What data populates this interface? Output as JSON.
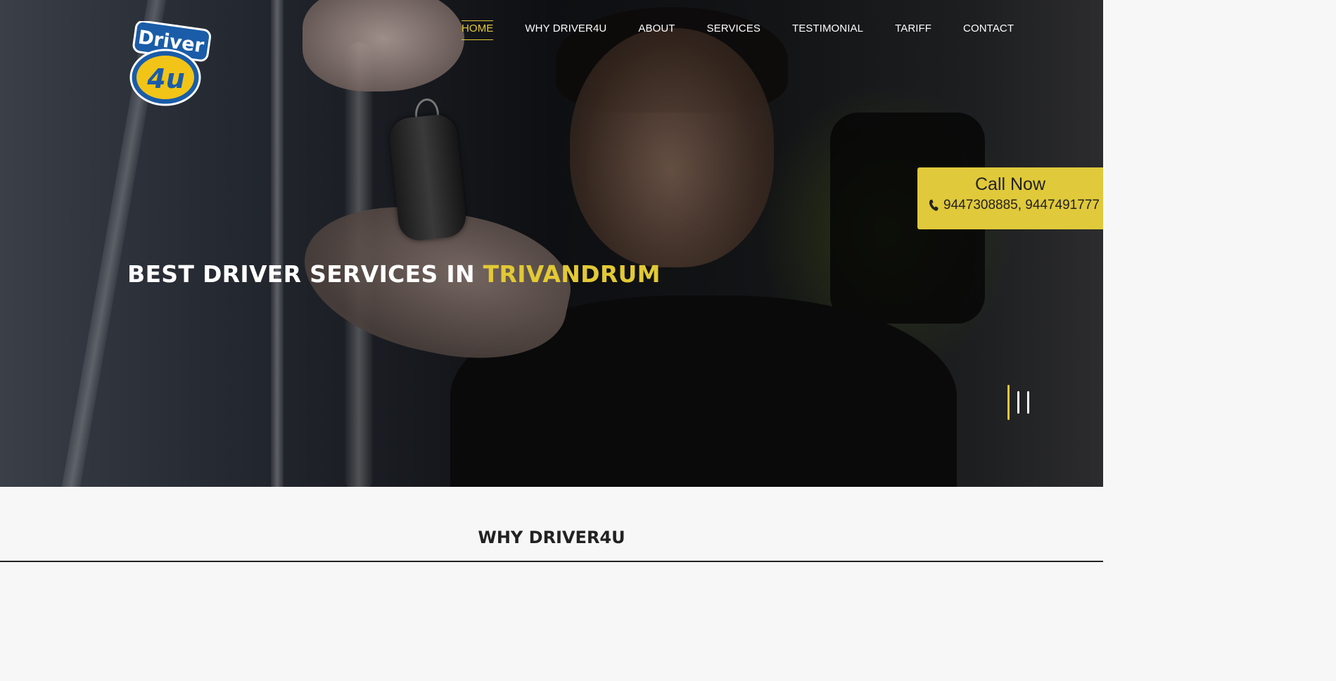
{
  "logo": {
    "line1": "Driver",
    "line2": "4u"
  },
  "nav": {
    "items": [
      {
        "label": "HOME",
        "active": true
      },
      {
        "label": "WHY DRIVER4U"
      },
      {
        "label": "ABOUT"
      },
      {
        "label": "SERVICES"
      },
      {
        "label": "TESTIMONIAL"
      },
      {
        "label": "TARIFF"
      },
      {
        "label": "CONTACT"
      }
    ]
  },
  "hero": {
    "headline_main": "BEST DRIVER SERVICES IN ",
    "headline_accent": "TRIVANDRUM",
    "slide_count": 3,
    "active_slide": 1
  },
  "call_box": {
    "title": "Call Now",
    "numbers": "9447308885, 9447491777",
    "icon": "phone-icon"
  },
  "section": {
    "title": "WHY DRIVER4U"
  },
  "colors": {
    "accent": "#e2c935",
    "call_box_bg": "#e0c93a",
    "text_dark": "#222222"
  }
}
